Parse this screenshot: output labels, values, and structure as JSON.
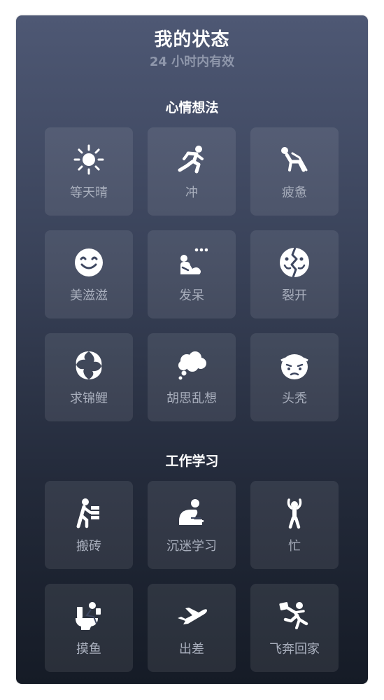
{
  "header": {
    "title": "我的状态",
    "subtitle": "24 小时内有效"
  },
  "sections": [
    {
      "title": "心情想法",
      "items": [
        {
          "label": "等天晴",
          "icon": "sun-icon"
        },
        {
          "label": "冲",
          "icon": "running-icon"
        },
        {
          "label": "疲惫",
          "icon": "reclining-tired-icon"
        },
        {
          "label": "美滋滋",
          "icon": "smile-face-icon"
        },
        {
          "label": "发呆",
          "icon": "daydream-icon"
        },
        {
          "label": "裂开",
          "icon": "cracked-face-icon"
        },
        {
          "label": "求锦鲤",
          "icon": "koi-fish-icon"
        },
        {
          "label": "胡思乱想",
          "icon": "thought-bubble-icon"
        },
        {
          "label": "头秃",
          "icon": "bald-head-icon"
        }
      ]
    },
    {
      "title": "工作学习",
      "items": [
        {
          "label": "搬砖",
          "icon": "carrying-bricks-icon"
        },
        {
          "label": "沉迷学习",
          "icon": "studying-icon"
        },
        {
          "label": "忙",
          "icon": "busy-person-icon"
        },
        {
          "label": "摸鱼",
          "icon": "slacking-toilet-icon"
        },
        {
          "label": "出差",
          "icon": "airplane-icon"
        },
        {
          "label": "飞奔回家",
          "icon": "rushing-home-icon"
        }
      ]
    }
  ],
  "colors": {
    "panel_top": "#4e5874",
    "panel_bottom": "#151b26",
    "tile_bg": "rgba(255,255,255,0.085)",
    "label": "#a9afbd",
    "icon": "#ffffff"
  }
}
